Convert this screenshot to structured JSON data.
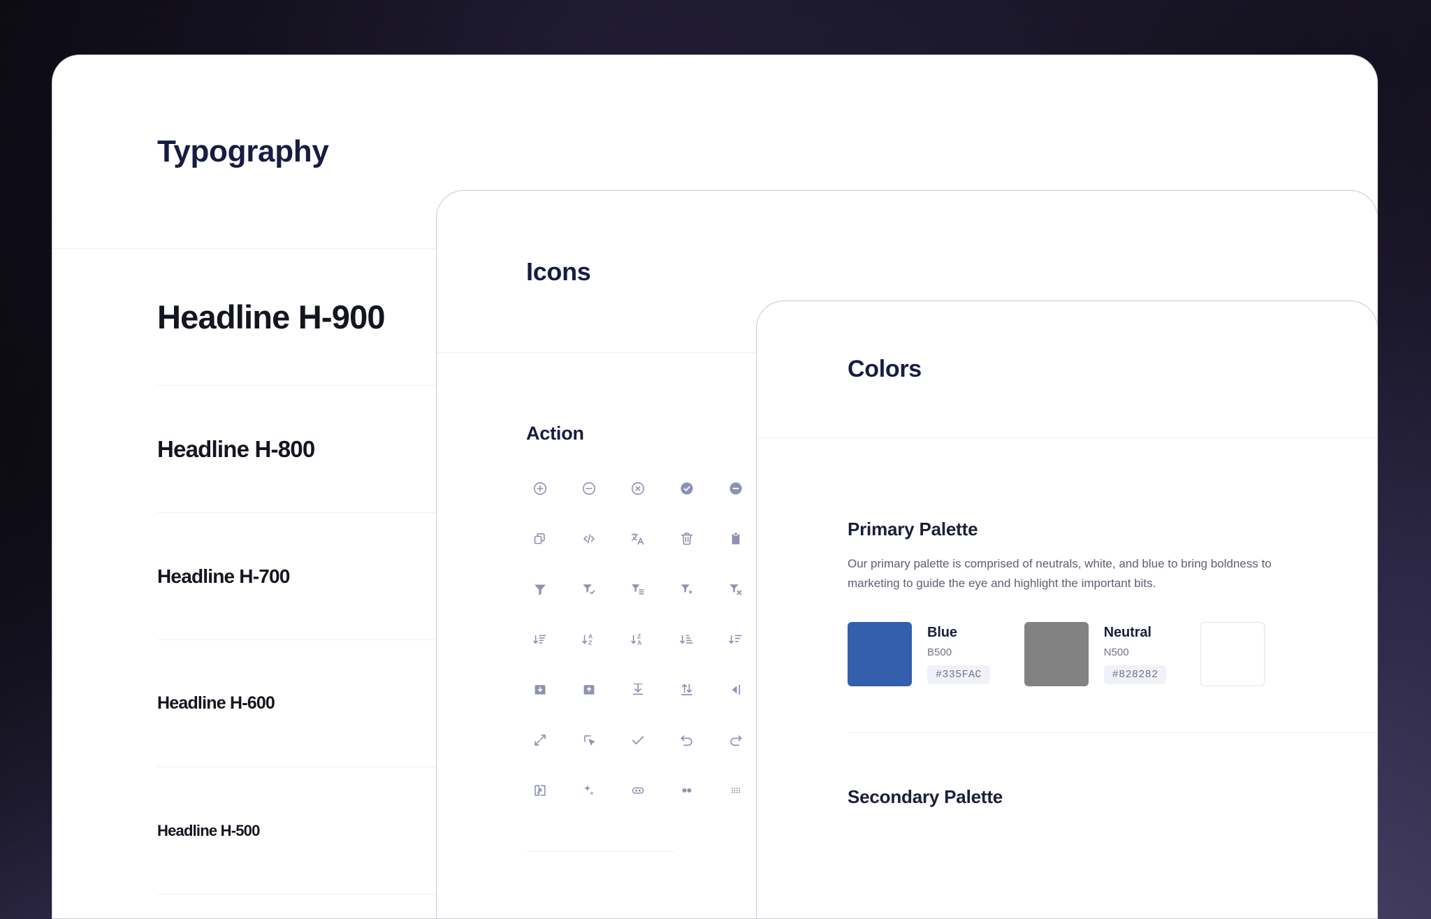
{
  "background": {
    "gradient_from": "#1a1626",
    "gradient_to": "#625a8d"
  },
  "typography_card": {
    "title": "Typography",
    "rows": [
      {
        "label": "Headline H-900",
        "size_class": "h900"
      },
      {
        "label": "Headline H-800",
        "size_class": "h800"
      },
      {
        "label": "Headline H-700",
        "size_class": "h700"
      },
      {
        "label": "Headline H-600",
        "size_class": "h600"
      },
      {
        "label": "Headline H-500",
        "size_class": "h500"
      }
    ]
  },
  "icons_card": {
    "title": "Icons",
    "group_title": "Action",
    "icon_color": "#8e92b2",
    "icons": [
      "plus-circle-icon",
      "minus-circle-icon",
      "close-circle-icon",
      "check-circle-filled-icon",
      "minus-circle-filled-icon",
      "copy-icon",
      "code-icon",
      "translate-icon",
      "trash-icon",
      "clipboard-icon",
      "filter-icon",
      "filter-check-icon",
      "filter-list-icon",
      "filter-play-icon",
      "filter-remove-icon",
      "sort-icon",
      "sort-a-z-icon",
      "sort-z-a-icon",
      "sort-ascending-icon",
      "sort-descending-icon",
      "archive-download-icon",
      "archive-upload-icon",
      "download-icon",
      "import-export-icon",
      "collapse-left-icon",
      "expand-icon",
      "select-cursor-icon",
      "check-icon",
      "undo-icon",
      "redo-icon",
      "share-external-icon",
      "sparkles-icon",
      "toggle-icon",
      "more-dots-icon",
      "grid-dots-icon"
    ]
  },
  "colors_card": {
    "title": "Colors",
    "primary": {
      "title": "Primary Palette",
      "description": "Our primary palette is comprised of neutrals, white, and blue to bring boldness to\nmarketing to guide the eye and highlight the important bits.",
      "swatches": [
        {
          "name": "Blue",
          "token": "B500",
          "hex": "#335FAC",
          "bordered": false
        },
        {
          "name": "Neutral",
          "token": "N500",
          "hex": "#828282",
          "bordered": false
        },
        {
          "name": "",
          "token": "",
          "hex": "#FFFFFF",
          "bordered": true
        }
      ]
    },
    "secondary": {
      "title": "Secondary Palette"
    }
  }
}
